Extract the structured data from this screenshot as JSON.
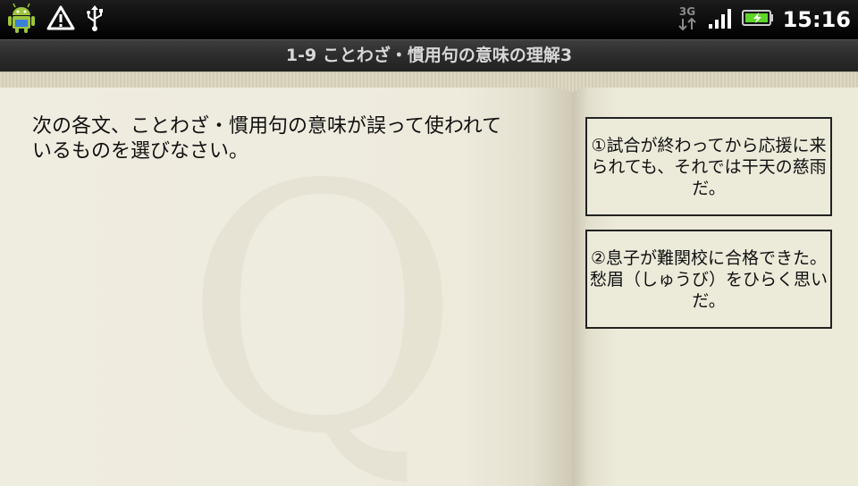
{
  "status_bar": {
    "time": "15:16",
    "network": "3G",
    "icons": [
      "android-icon",
      "warning-icon",
      "usb-icon",
      "3g-data-icon",
      "signal-icon",
      "battery-charging-icon"
    ]
  },
  "title_bar": {
    "title": "1-9 ことわざ・慣用句の意味の理解3"
  },
  "watermark": {
    "letter": "Q"
  },
  "question": {
    "text": "次の各文、ことわざ・慣用句の意味が誤って使われているものを選びなさい。"
  },
  "answers": [
    {
      "label": "①試合が終わってから応援に来られても、それでは干天の慈雨だ。"
    },
    {
      "label": "②息子が難関校に合格できた。愁眉（しゅうび）をひらく思いだ。"
    }
  ],
  "colors": {
    "page": "#eeebdd",
    "text": "#111111",
    "title_text": "#d8d8d8",
    "battery_green": "#5fd62a"
  }
}
